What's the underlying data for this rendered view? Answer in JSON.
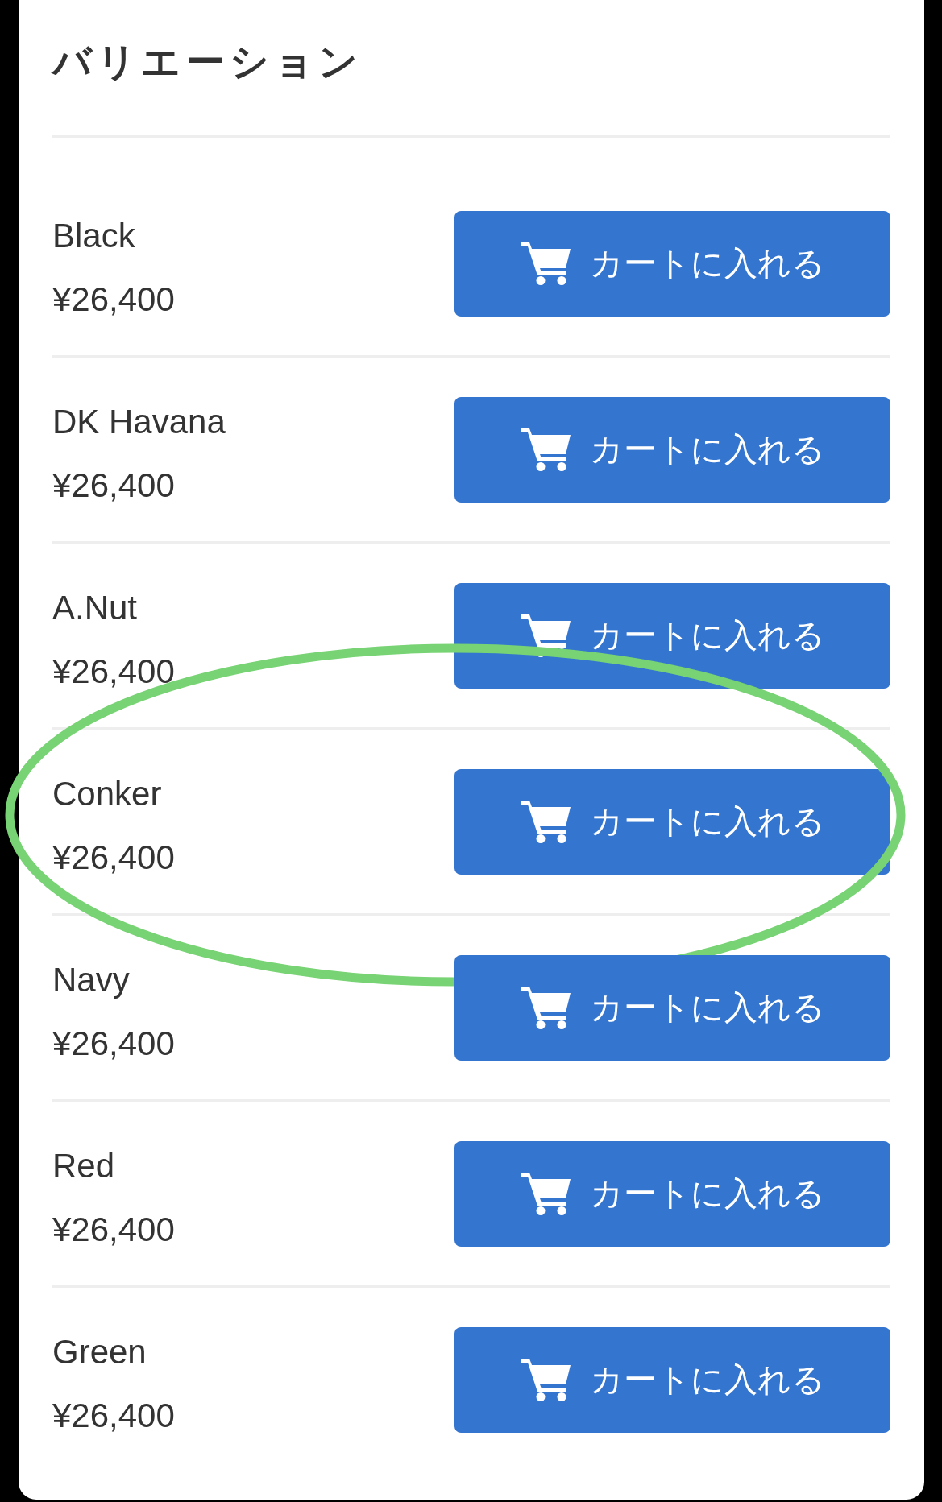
{
  "section": {
    "title": "バリエーション"
  },
  "rows": [
    {
      "name": "Black",
      "price": "¥26,400",
      "button": "カートに入れる",
      "circled": false
    },
    {
      "name": "DK Havana",
      "price": "¥26,400",
      "button": "カートに入れる",
      "circled": false
    },
    {
      "name": "A.Nut",
      "price": "¥26,400",
      "button": "カートに入れる",
      "circled": false
    },
    {
      "name": "Conker",
      "price": "¥26,400",
      "button": "カートに入れる",
      "circled": true
    },
    {
      "name": "Navy",
      "price": "¥26,400",
      "button": "カートに入れる",
      "circled": false
    },
    {
      "name": "Red",
      "price": "¥26,400",
      "button": "カートに入れる",
      "circled": false
    },
    {
      "name": "Green",
      "price": "¥26,400",
      "button": "カートに入れる",
      "circled": false
    }
  ]
}
